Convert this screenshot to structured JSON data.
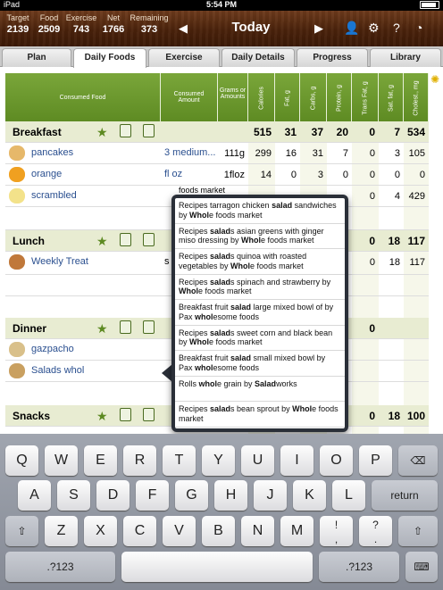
{
  "status_bar": {
    "carrier": "iPad",
    "time": "5:54 PM"
  },
  "summary": [
    {
      "label": "Target",
      "value": "2139"
    },
    {
      "label": "Food",
      "value": "2509"
    },
    {
      "label": "Exercise",
      "value": "743"
    },
    {
      "label": "Net",
      "value": "1766"
    },
    {
      "label": "Remaining",
      "value": "373"
    }
  ],
  "header": {
    "title": "Today",
    "prev_icon": "triangle-left",
    "next_icon": "triangle-right"
  },
  "tabs": [
    "Plan",
    "Daily Foods",
    "Exercise",
    "Daily Details",
    "Progress",
    "Library"
  ],
  "active_tab": "Daily Foods",
  "columns": {
    "food": "Consumed Food",
    "amount": "Consumed Amount",
    "grams": "Grams or Amounts",
    "nutrients": [
      "Calories",
      "Fat, g",
      "Carbs, g",
      "Protein, g",
      "Trans Fat, g",
      "Sat. fat, g",
      "Cholest., mg"
    ]
  },
  "sections": [
    {
      "name": "Breakfast",
      "totals": [
        "515",
        "31",
        "37",
        "20",
        "0",
        "7",
        "534"
      ],
      "foods": [
        {
          "name": "pancakes",
          "amount": "3 medium...",
          "grams": "111g",
          "values": [
            "299",
            "16",
            "31",
            "7",
            "0",
            "3",
            "105"
          ]
        },
        {
          "name": "orange",
          "amount": "fl oz",
          "grams": "1floz",
          "values": [
            "14",
            "0",
            "3",
            "0",
            "0",
            "0",
            "0"
          ]
        },
        {
          "name": "scrambled",
          "amount": "",
          "grams": "",
          "values": [
            "",
            "",
            "",
            "",
            "0",
            "4",
            "429"
          ]
        }
      ]
    },
    {
      "name": "Lunch",
      "totals": [
        "",
        "",
        "",
        "",
        "0",
        "18",
        "117"
      ],
      "foods": [
        {
          "name": "Weekly Treat",
          "amount": "s",
          "grams": "",
          "values": [
            "",
            "",
            "",
            "",
            "0",
            "18",
            "117"
          ]
        }
      ]
    },
    {
      "name": "Dinner",
      "totals": [
        "",
        "",
        "",
        "",
        "0",
        "",
        ""
      ],
      "foods": [
        {
          "name": "gazpacho",
          "amount": "",
          "grams": "",
          "values": [
            "",
            "",
            "",
            "",
            "",
            "",
            ""
          ]
        },
        {
          "name": "Salads whol",
          "amount": "",
          "grams": "",
          "values": [
            "",
            "",
            "",
            "",
            "",
            "",
            ""
          ]
        }
      ]
    },
    {
      "name": "Snacks",
      "totals": [
        "",
        "",
        "",
        "",
        "0",
        "18",
        "100"
      ],
      "foods": []
    }
  ],
  "scrambled_amount_partial": "foods market",
  "suggestions": [
    {
      "before": "Recipes tarragon chicken ",
      "b1": "salad",
      "mid": " sandwiches by ",
      "b2": "Whol",
      "after": "e foods market"
    },
    {
      "before": "Recipes ",
      "b1": "salad",
      "mid": "s asian greens with ginger miso dressing by ",
      "b2": "Whol",
      "after": "e foods market"
    },
    {
      "before": "Recipes ",
      "b1": "salad",
      "mid": "s quinoa with roasted vegetables by ",
      "b2": "Whol",
      "after": "e foods market"
    },
    {
      "before": "Recipes ",
      "b1": "salad",
      "mid": "s spinach and strawberry by ",
      "b2": "Whol",
      "after": "e foods market"
    },
    {
      "before": "Breakfast fruit ",
      "b1": "salad",
      "mid": " large mixed bowl of by Pax ",
      "b2": "whol",
      "after": "esome foods"
    },
    {
      "before": "Recipes ",
      "b1": "salad",
      "mid": "s sweet corn and black bean by ",
      "b2": "Whol",
      "after": "e foods market"
    },
    {
      "before": "Breakfast fruit ",
      "b1": "salad",
      "mid": " small mixed bowl by Pax ",
      "b2": "whol",
      "after": "esome foods"
    },
    {
      "before": "Rolls ",
      "b1": "whol",
      "mid": "e grain by ",
      "b2": "Salad",
      "after": "works"
    },
    {
      "before": "Recipes ",
      "b1": "salad",
      "mid": "s bean sprout by ",
      "b2": "Whol",
      "after": "e foods market"
    }
  ],
  "keyboard": {
    "row1": [
      "Q",
      "W",
      "E",
      "R",
      "T",
      "Y",
      "U",
      "I",
      "O",
      "P"
    ],
    "row2": [
      "A",
      "S",
      "D",
      "F",
      "G",
      "H",
      "J",
      "K",
      "L"
    ],
    "row3": [
      "Z",
      "X",
      "C",
      "V",
      "B",
      "N",
      "M",
      "!",
      "?"
    ],
    "row3_sub": [
      ",",
      "."
    ],
    "return_label": "return",
    "numbers_label": ".?123"
  }
}
